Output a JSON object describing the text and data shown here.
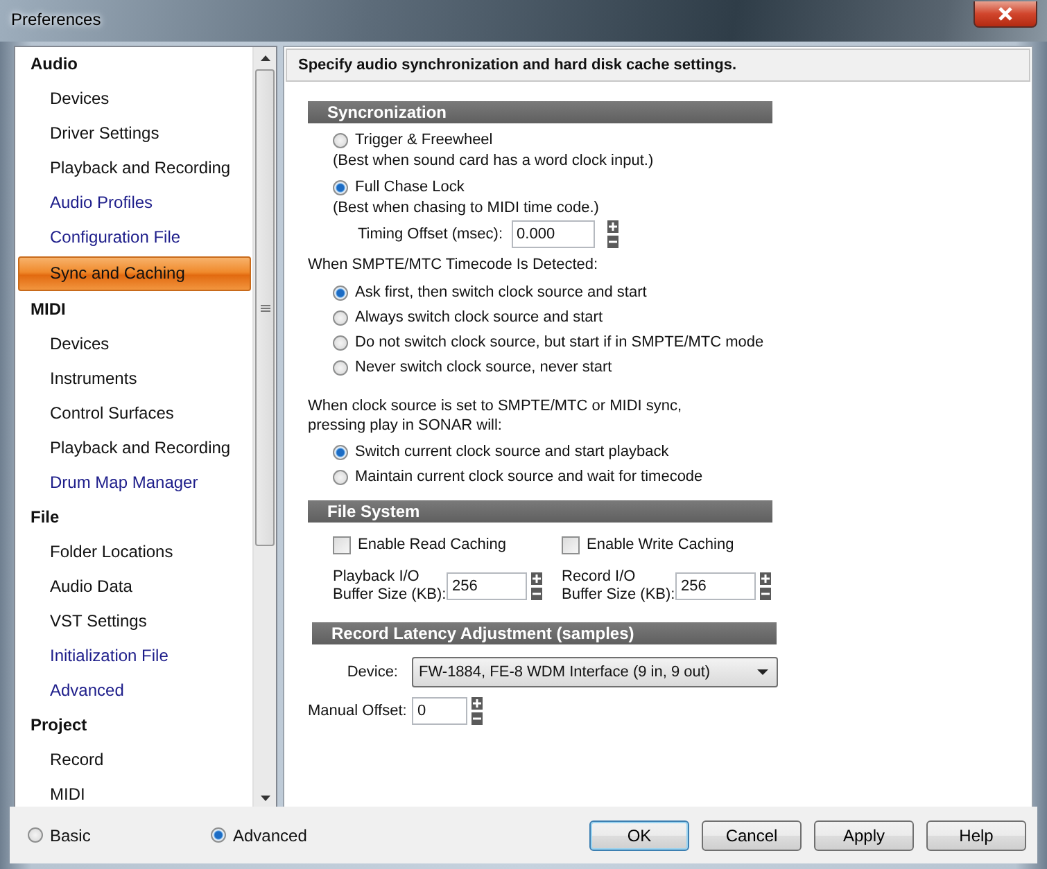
{
  "window": {
    "title": "Preferences"
  },
  "sidebar": {
    "groups": [
      {
        "label": "Audio",
        "children": [
          {
            "label": "Devices",
            "kind": "page",
            "selected": false
          },
          {
            "label": "Driver Settings",
            "kind": "page",
            "selected": false
          },
          {
            "label": "Playback and Recording",
            "kind": "page",
            "selected": false
          },
          {
            "label": "Audio Profiles",
            "kind": "link",
            "selected": false
          },
          {
            "label": "Configuration File",
            "kind": "link",
            "selected": false
          },
          {
            "label": "Sync and Caching",
            "kind": "page",
            "selected": true
          }
        ]
      },
      {
        "label": "MIDI",
        "children": [
          {
            "label": "Devices",
            "kind": "page",
            "selected": false
          },
          {
            "label": "Instruments",
            "kind": "page",
            "selected": false
          },
          {
            "label": "Control Surfaces",
            "kind": "page",
            "selected": false
          },
          {
            "label": "Playback and Recording",
            "kind": "page",
            "selected": false
          },
          {
            "label": "Drum Map Manager",
            "kind": "link",
            "selected": false
          }
        ]
      },
      {
        "label": "File",
        "children": [
          {
            "label": "Folder Locations",
            "kind": "page",
            "selected": false
          },
          {
            "label": "Audio Data",
            "kind": "page",
            "selected": false
          },
          {
            "label": "VST Settings",
            "kind": "page",
            "selected": false
          },
          {
            "label": "Initialization File",
            "kind": "link",
            "selected": false
          },
          {
            "label": "Advanced",
            "kind": "link",
            "selected": false
          }
        ]
      },
      {
        "label": "Project",
        "children": [
          {
            "label": "Record",
            "kind": "page",
            "selected": false
          },
          {
            "label": "MIDI",
            "kind": "page",
            "selected": false
          }
        ]
      }
    ]
  },
  "header": "Specify audio synchronization and hard disk cache settings.",
  "sync": {
    "title": "Syncronization",
    "modes": [
      {
        "label": "Trigger & Freewheel",
        "note": "(Best when sound card has a word clock input.)",
        "selected": false
      },
      {
        "label": "Full Chase Lock",
        "note": "(Best when chasing to MIDI time code.)",
        "selected": true
      }
    ],
    "timing_offset": {
      "label": "Timing Offset (msec):",
      "value": "0.000"
    },
    "detect_label": "When SMPTE/MTC Timecode Is Detected:",
    "detect_options": [
      {
        "label": "Ask first, then switch clock source and start",
        "selected": true
      },
      {
        "label": "Always switch clock source and start",
        "selected": false
      },
      {
        "label": "Do not switch clock source, but start if in SMPTE/MTC mode",
        "selected": false
      },
      {
        "label": "Never switch clock source, never start",
        "selected": false
      }
    ],
    "play_label": "When clock source is set to SMPTE/MTC or MIDI sync,\npressing play in SONAR will:",
    "play_options": [
      {
        "label": "Switch current clock source and start playback",
        "selected": true
      },
      {
        "label": "Maintain current clock source and wait for timecode",
        "selected": false
      }
    ]
  },
  "file_system": {
    "title": "File System",
    "caching": [
      {
        "label": "Enable Read Caching",
        "checked": false
      },
      {
        "label": "Enable Write Caching",
        "checked": false
      }
    ],
    "buffers": [
      {
        "label": "Playback I/O\nBuffer Size (KB):",
        "value": "256"
      },
      {
        "label": "Record I/O\nBuffer Size (KB):",
        "value": "256"
      }
    ]
  },
  "latency": {
    "title": "Record Latency Adjustment (samples)",
    "device": {
      "label": "Device:",
      "value": "FW-1884, FE-8 WDM Interface (9 in, 9 out)"
    },
    "manual_offset": {
      "label": "Manual Offset:",
      "value": "0"
    }
  },
  "mode": [
    {
      "label": "Basic",
      "selected": false
    },
    {
      "label": "Advanced",
      "selected": true
    }
  ],
  "buttons": [
    {
      "label": "OK",
      "default": true
    },
    {
      "label": "Cancel",
      "default": false
    },
    {
      "label": "Apply",
      "default": false
    },
    {
      "label": "Help",
      "default": false
    }
  ]
}
